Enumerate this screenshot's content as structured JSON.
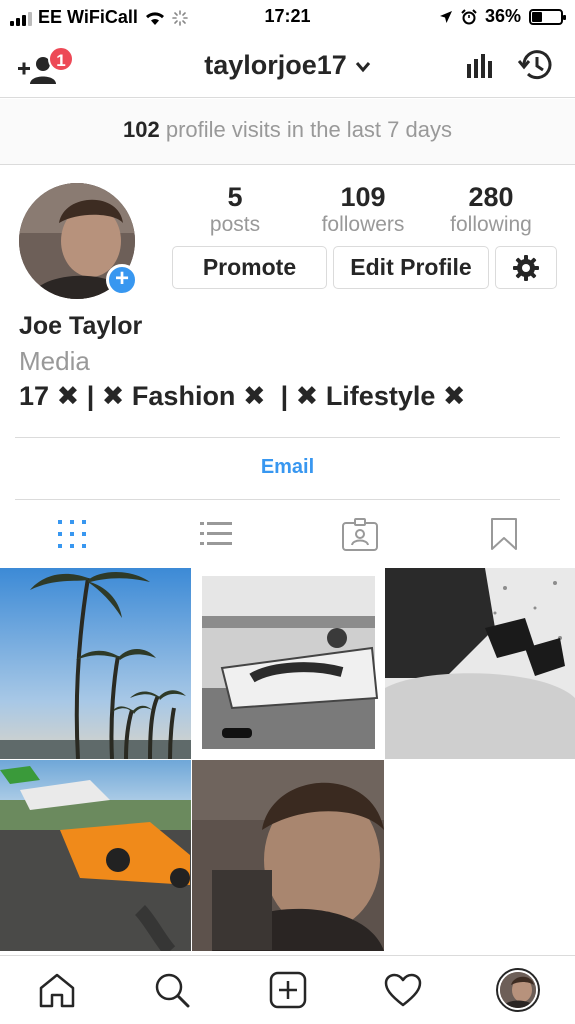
{
  "status_bar": {
    "carrier": "EE WiFiCall",
    "time": "17:21",
    "battery_percent": "36%",
    "battery_level": 0.36
  },
  "topnav": {
    "notification_count": "1",
    "username": "taylorjoe17"
  },
  "visits": {
    "count": "102",
    "text": "profile visits in the last 7 days"
  },
  "stats": [
    {
      "value": "5",
      "label": "posts"
    },
    {
      "value": "109",
      "label": "followers"
    },
    {
      "value": "280",
      "label": "following"
    }
  ],
  "buttons": {
    "promote": "Promote",
    "edit_profile": "Edit Profile"
  },
  "profile": {
    "full_name": "Joe Taylor",
    "category": "Media",
    "bio_age": "17",
    "bio_sep": "|",
    "bio_fashion": "Fashion",
    "bio_lifestyle": "Lifestyle"
  },
  "contact": {
    "email_label": "Email"
  },
  "tabs": [
    "grid-icon",
    "list-icon",
    "tagged-icon",
    "saved-icon"
  ],
  "grid_posts": [
    {
      "name": "palm-trees-photo"
    },
    {
      "name": "poolside-photo"
    },
    {
      "name": "shoes-photo"
    },
    {
      "name": "supercars-photo"
    },
    {
      "name": "selfie-photo"
    }
  ],
  "colors": {
    "accent_blue": "#3897f0",
    "badge_red": "#ed4956",
    "text_dark": "#262626",
    "text_grey": "#999999",
    "border": "#dbdbdb"
  },
  "bottom_nav": [
    "home-icon",
    "search-icon",
    "new-post-icon",
    "activity-icon",
    "profile-avatar"
  ]
}
